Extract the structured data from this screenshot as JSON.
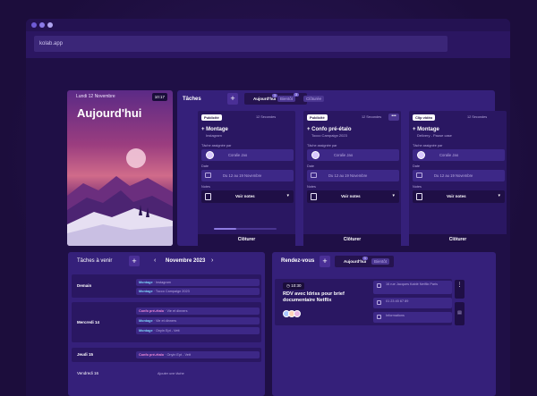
{
  "browser": {
    "url": "kolab.app"
  },
  "hero": {
    "date": "Lundi 12 Novembre",
    "time": "10:17",
    "title": "Aujourd'hui"
  },
  "tasks": {
    "title": "Tâches",
    "add": "+",
    "tabs": [
      {
        "label": "Aujourd'hui",
        "count": "3"
      },
      {
        "label": "Bientôt",
        "count": "3"
      },
      {
        "label": "Clôturée",
        "count": ""
      }
    ],
    "cards": [
      {
        "tag": "Publicité",
        "duration": "12 Secondes",
        "title": "Montage",
        "subtitle": "Instagram",
        "assigned_label": "Tâche assignée par",
        "assigned": "Coralie Jao",
        "date_label": "Date",
        "date": "Du 12 au 19 Novembre",
        "notes_label": "Notes",
        "notes": "Voir notes",
        "close": "Clôturer",
        "progress": 0.35
      },
      {
        "tag": "Publicité",
        "duration": "12 Secondes",
        "title": "Confo pré-étalo",
        "subtitle": "Tocco Campaign 2023",
        "assigned_label": "Tâche assignée par",
        "assigned": "Coralie Jao",
        "date_label": "Date",
        "date": "Du 12 au 19 Novembre",
        "notes_label": "Notes",
        "notes": "Voir notes",
        "close": "Clôturer",
        "progress": 0.35
      },
      {
        "tag": "Clip vidéo",
        "duration": "12 Secondes",
        "title": "Montage",
        "subtitle": "Delivery - Pause case",
        "assigned_label": "Tâche assignée par",
        "assigned": "Coralie Jao",
        "date_label": "Date",
        "date": "Du 12 au 19 Novembre",
        "notes_label": "Notes",
        "notes": "Voir notes",
        "close": "Clôturer",
        "progress": 0.35
      }
    ]
  },
  "upcoming": {
    "title": "Tâches à venir",
    "add": "+",
    "month": "Novembre 2023",
    "days": [
      {
        "day": "Demain",
        "events": [
          {
            "label": "Montage",
            "detail": "Instagram"
          },
          {
            "label": "Montage",
            "detail": "Tocco Campaign 2023"
          }
        ]
      },
      {
        "day": "Mercredi 14",
        "events": [
          {
            "label": "Confo pré-étalo",
            "detail": "Vie et dinners"
          },
          {
            "label": "Montage",
            "detail": "Vie et dinners"
          },
          {
            "label": "Montage",
            "detail": "Onyin Ept - Vett"
          }
        ]
      },
      {
        "day": "Jeudi 15",
        "events": [
          {
            "label": "Confo pré-étalo",
            "detail": "Onyin Ept - Vett"
          }
        ]
      },
      {
        "day": "Vendredi 16",
        "events": []
      }
    ],
    "add_task": "Ajouter une tâche"
  },
  "rdv": {
    "title": "Rendez-vous",
    "add": "+",
    "tabs": [
      {
        "label": "Aujourd'hui",
        "count": "1"
      },
      {
        "label": "Bientôt",
        "count": ""
      }
    ],
    "appointment": {
      "time": "10:30",
      "title": "RDV avec Idriss pour brief documentaire Netflix",
      "location": "16 rue Jacques Kablé Netflix Paris",
      "phone": "01 23 45 67 89",
      "notes": "Informations"
    }
  }
}
